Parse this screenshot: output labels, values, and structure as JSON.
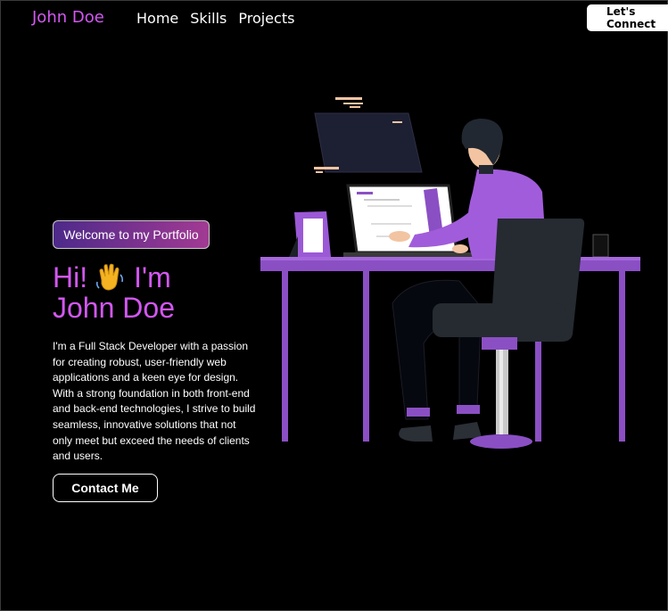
{
  "header": {
    "logo": "John Doe",
    "nav": [
      "Home",
      "Skills",
      "Projects"
    ],
    "cta": "Let's Connect"
  },
  "hero": {
    "badge": "Welcome to my Portfolio",
    "greeting_hi": "Hi!",
    "greeting_im": "I'm",
    "name": "John Doe",
    "bio": "I'm a Full Stack Developer with a passion for creating robust, user-friendly web applications and a keen eye for design. With a strong foundation in both front-end and back-end technologies, I strive to build seamless, innovative solutions that not only meet but exceed the needs of clients and users.",
    "contact_button": "Contact Me"
  },
  "icons": {
    "wave": "waving-hand-icon"
  },
  "colors": {
    "accent": "#d357f2",
    "purple": "#9b59d6",
    "background": "#000000"
  }
}
